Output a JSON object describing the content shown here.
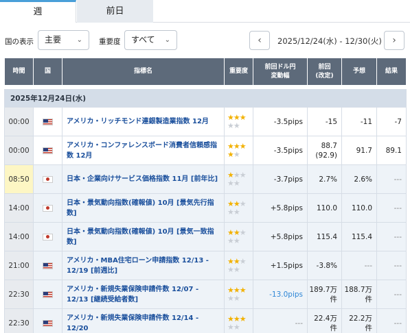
{
  "tabs": [
    {
      "label": "週",
      "active": true
    },
    {
      "label": "前日",
      "active": false
    }
  ],
  "filters": {
    "country_label": "国の表示",
    "country_value": "主要",
    "importance_label": "重要度",
    "importance_value": "すべて",
    "date_range": "2025/12/24(水) - 12/30(火)",
    "prev_icon": "chevron-left-icon",
    "next_icon": "chevron-right-icon"
  },
  "columns": [
    "時間",
    "国",
    "指標名",
    "重要度",
    "前回ドル円\n変動幅",
    "前回\n(改定)",
    "予想",
    "結果"
  ],
  "date_header": "2025年12月24日(水)",
  "colors": {
    "header_bg": "#5d6a7a",
    "accent": "#4a9fd8",
    "star": "#f2b100",
    "link": "#1a4f9c",
    "neg_pips": "#2e86d6"
  },
  "rows": [
    {
      "time": "00:00",
      "highlight": false,
      "country": "us",
      "country_icon": "us-flag-icon",
      "name": "アメリカ・リッチモンド連銀製造業指数 12月",
      "stars": 3,
      "pips": "-3.5pips",
      "pips_style": "normal",
      "prev": "-15",
      "prev_rev": "",
      "forecast": "-11",
      "result": "-7"
    },
    {
      "time": "00:00",
      "highlight": false,
      "country": "us",
      "country_icon": "us-flag-icon",
      "name": "アメリカ・コンファレンスボード消費者信頼感指数 12月",
      "stars": 4,
      "pips": "-3.5pips",
      "pips_style": "normal",
      "prev": "88.7",
      "prev_rev": "(92.9)",
      "forecast": "91.7",
      "result": "89.1"
    },
    {
      "time": "08:50",
      "highlight": true,
      "country": "jp",
      "country_icon": "japan-flag-icon",
      "name": "日本・企業向けサービス価格指数 11月 [前年比]",
      "stars": 1,
      "pips": "-3.7pips",
      "pips_style": "normal",
      "prev": "2.7%",
      "prev_rev": "",
      "forecast": "2.6%",
      "result": "---"
    },
    {
      "time": "14:00",
      "highlight": false,
      "country": "jp",
      "country_icon": "japan-flag-icon",
      "name": "日本・景気動向指数(確報値) 10月 [景気先行指数]",
      "stars": 2,
      "pips": "+5.8pips",
      "pips_style": "normal",
      "prev": "110.0",
      "prev_rev": "",
      "forecast": "110.0",
      "result": "---"
    },
    {
      "time": "14:00",
      "highlight": false,
      "country": "jp",
      "country_icon": "japan-flag-icon",
      "name": "日本・景気動向指数(確報値) 10月 [景気一致指数]",
      "stars": 2,
      "pips": "+5.8pips",
      "pips_style": "normal",
      "prev": "115.4",
      "prev_rev": "",
      "forecast": "115.4",
      "result": "---"
    },
    {
      "time": "21:00",
      "highlight": false,
      "country": "us",
      "country_icon": "us-flag-icon",
      "name": "アメリカ・MBA住宅ローン申請指数 12/13 - 12/19 [前週比]",
      "stars": 2,
      "pips": "+1.5pips",
      "pips_style": "normal",
      "prev": "-3.8%",
      "prev_rev": "",
      "forecast": "---",
      "result": "---"
    },
    {
      "time": "22:30",
      "highlight": false,
      "country": "us",
      "country_icon": "us-flag-icon",
      "name": "アメリカ・新規失業保険申請件数 12/07 - 12/13 [継続受給者数]",
      "stars": 3,
      "pips": "-13.0pips",
      "pips_style": "neg",
      "prev": "189.7万件",
      "prev_rev": "",
      "forecast": "188.7万件",
      "result": "---"
    },
    {
      "time": "22:30",
      "highlight": false,
      "country": "us",
      "country_icon": "us-flag-icon",
      "name": "アメリカ・新規失業保険申請件数 12/14 - 12/20",
      "stars": 3,
      "pips": "---",
      "pips_style": "dash",
      "prev": "22.4万件",
      "prev_rev": "",
      "forecast": "22.2万件",
      "result": "---"
    }
  ]
}
